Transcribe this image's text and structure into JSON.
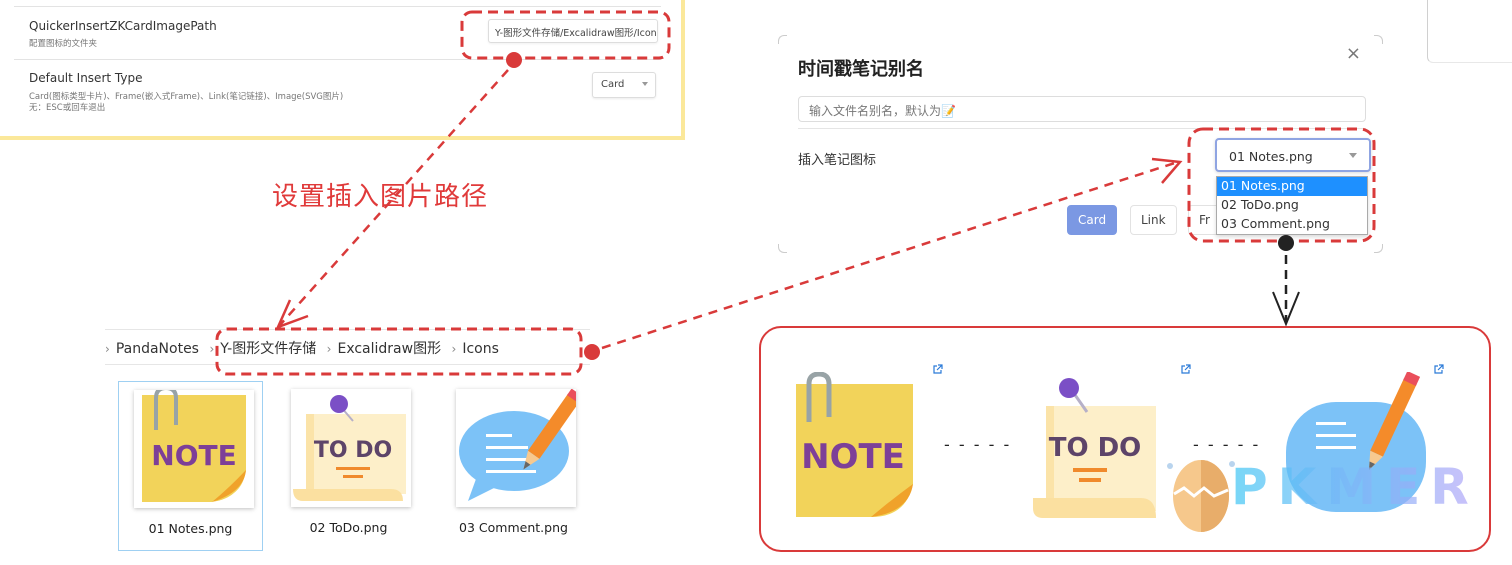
{
  "settings": {
    "image_path": {
      "name": "QuickerInsertZKCardImagePath",
      "description": "配置图标的文件夹",
      "value": "Y-图形文件存储/Excalidraw图形/Icons"
    },
    "insert_type": {
      "name": "Default Insert Type",
      "description_line1": "Card(图标类型卡片)、Frame(嵌入式Frame)、Link(笔记链接)、Image(SVG图片)",
      "description_line2": "无：ESC或回车退出",
      "value": "Card"
    }
  },
  "callout": {
    "text": "设置插入图片路径",
    "color": "#e03a3a"
  },
  "breadcrumb": {
    "items": [
      "PandaNotes",
      "Y-图形文件存储",
      "Excalidraw图形",
      "Icons"
    ]
  },
  "files": [
    {
      "name": "01 Notes.png",
      "icon": "note-icon",
      "selected": true
    },
    {
      "name": "02 ToDo.png",
      "icon": "todo-icon",
      "selected": false
    },
    {
      "name": "03 Comment.png",
      "icon": "comment-icon",
      "selected": false
    }
  ],
  "dialog": {
    "title": "时间戳笔记别名",
    "close": "×",
    "alias_placeholder": "输入文件名别名，默认为📝",
    "icon_label": "插入笔记图标",
    "icon_select": {
      "value": "01 Notes.png",
      "options": [
        "01 Notes.png",
        "02 ToDo.png",
        "03 Comment.png"
      ],
      "active_index": 0
    },
    "buttons": {
      "card": "Card",
      "link": "Link",
      "frame": "Fr"
    }
  },
  "preview": {
    "icons": [
      "note-icon",
      "todo-icon",
      "comment-icon"
    ],
    "connector": "- - - - -",
    "watermark": "PKMER"
  },
  "colors": {
    "accent_red": "#d93a3a",
    "panel_border": "#fbe89a",
    "primary_button": "#7b98e3",
    "dropdown_active": "#1e90ff"
  }
}
